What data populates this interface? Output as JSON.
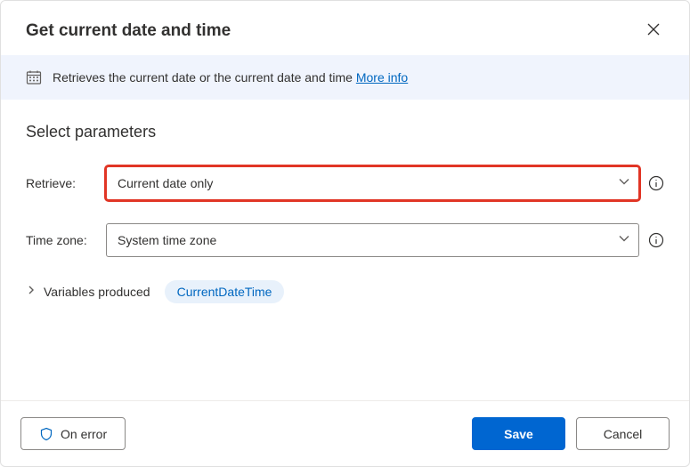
{
  "header": {
    "title": "Get current date and time"
  },
  "banner": {
    "text": "Retrieves the current date or the current date and time ",
    "more_info_label": "More info"
  },
  "section_title": "Select parameters",
  "params": {
    "retrieve": {
      "label": "Retrieve:",
      "value": "Current date only"
    },
    "timezone": {
      "label": "Time zone:",
      "value": "System time zone"
    }
  },
  "variables": {
    "label": "Variables produced",
    "chip": "CurrentDateTime"
  },
  "footer": {
    "on_error": "On error",
    "save": "Save",
    "cancel": "Cancel"
  }
}
